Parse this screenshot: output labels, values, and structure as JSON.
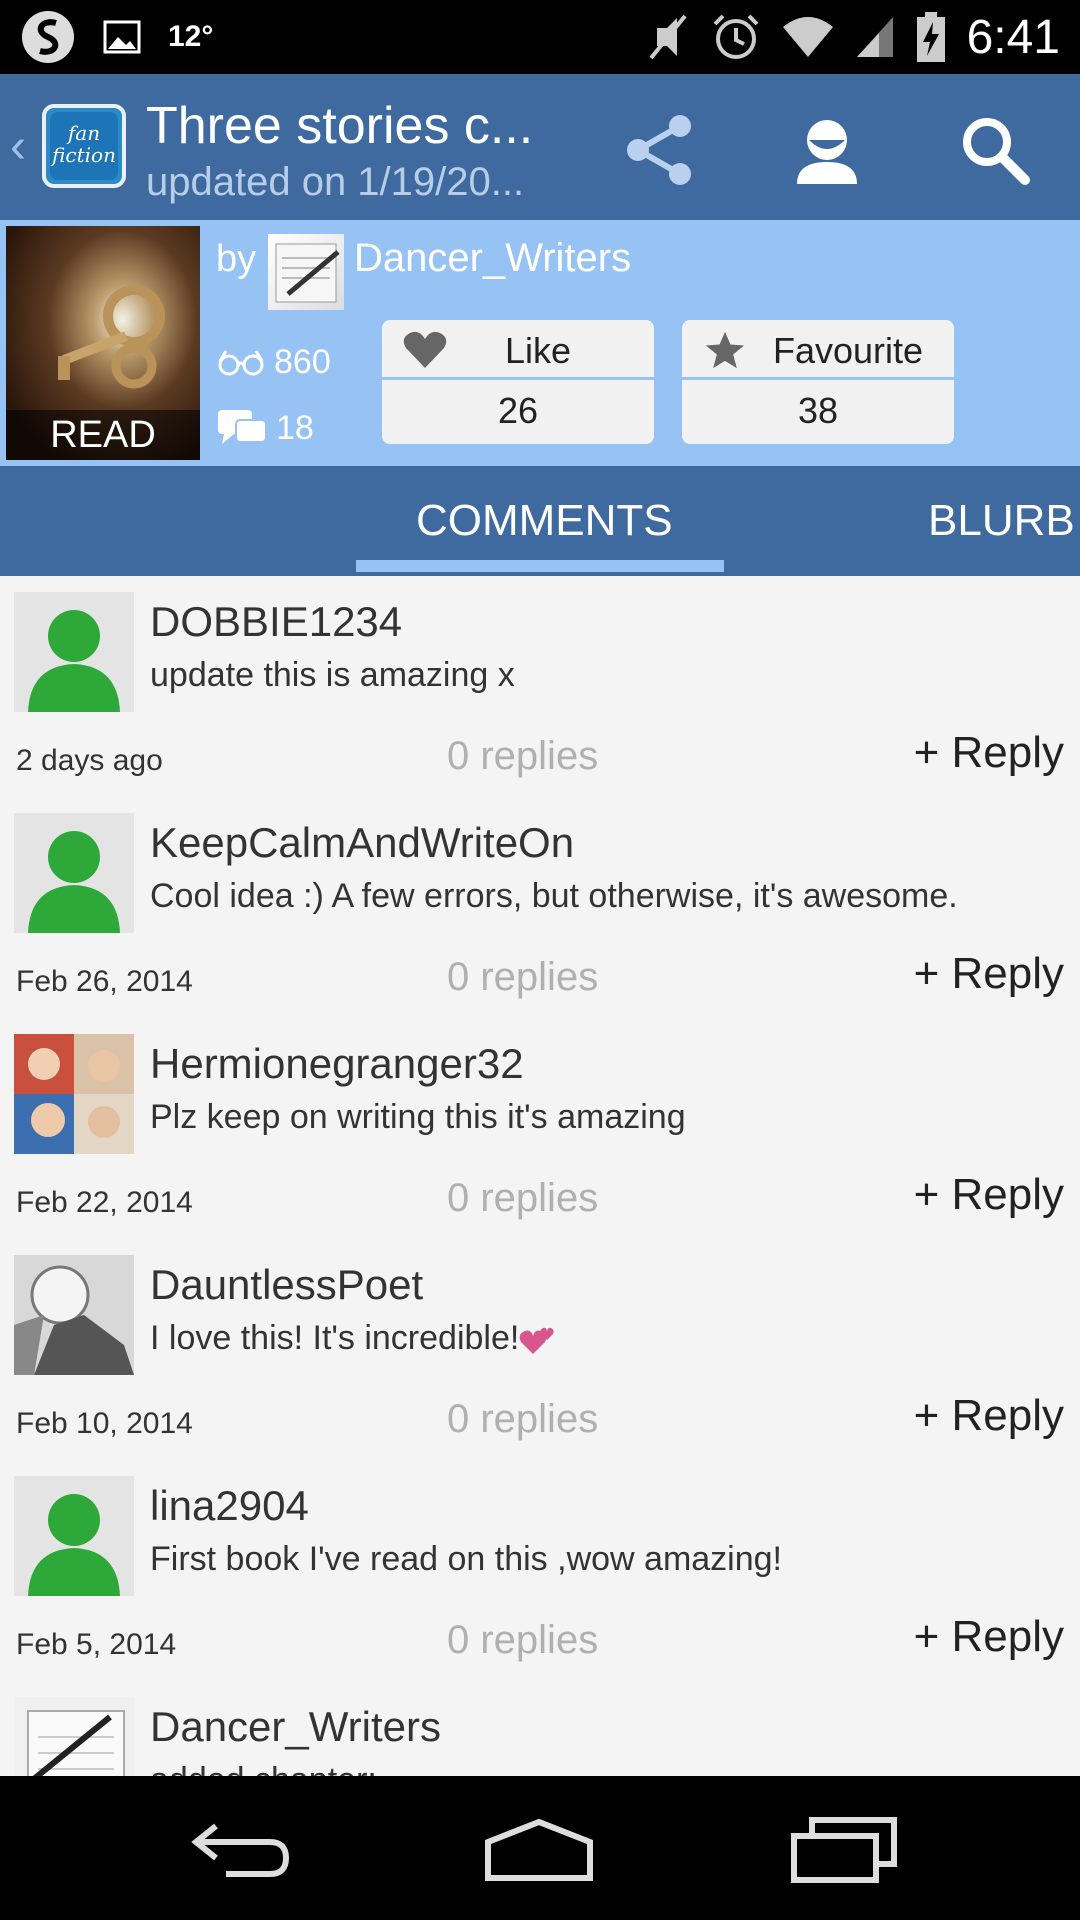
{
  "status_bar": {
    "temperature": "12°",
    "time": "6:41",
    "icons": [
      "swype-icon",
      "image-notification-icon",
      "mute-icon",
      "alarm-icon",
      "wifi-icon",
      "cell-signal-icon",
      "battery-charging-icon"
    ]
  },
  "action_bar": {
    "title": "Three stories c...",
    "subtitle": "updated on 1/19/20...",
    "logo_text": "fan fiction",
    "icons": [
      "share-icon",
      "profile-icon",
      "search-icon"
    ]
  },
  "story": {
    "cover_label": "READ",
    "by_label": "by",
    "author": "Dancer_Writers",
    "views": "860",
    "comments_count": "18",
    "like": {
      "label": "Like",
      "count": "26"
    },
    "favourite": {
      "label": "Favourite",
      "count": "38"
    }
  },
  "tabs": [
    {
      "label": "COMMENTS",
      "selected": true
    },
    {
      "label": "BLURB",
      "selected": false
    }
  ],
  "comments": [
    {
      "user": "DOBBIE1234",
      "text": "update this is amazing x",
      "date": "2 days ago",
      "replies": "0 replies",
      "reply_label": "+ Reply",
      "avatar": "default"
    },
    {
      "user": "KeepCalmAndWriteOn",
      "text": "Cool idea :) A few errors, but otherwise, it's awesome.",
      "date": "Feb 26, 2014",
      "replies": "0 replies",
      "reply_label": "+ Reply",
      "avatar": "default"
    },
    {
      "user": "Hermionegranger32",
      "text": "Plz keep on writing this it's amazing",
      "date": "Feb 22, 2014",
      "replies": "0 replies",
      "reply_label": "+ Reply",
      "avatar": "photo-band"
    },
    {
      "user": "DauntlessPoet",
      "text": "I love this! It's incredible!",
      "date": "Feb 10, 2014",
      "replies": "0 replies",
      "reply_label": "+ Reply",
      "avatar": "photo-bw"
    },
    {
      "user": "lina2904",
      "text": "First book I've read on this ,wow amazing!",
      "date": "Feb 5, 2014",
      "replies": "0 replies",
      "reply_label": "+ Reply",
      "avatar": "default"
    },
    {
      "user": "Dancer_Writers",
      "text": "added chapter:",
      "date": "",
      "replies": "",
      "reply_label": "",
      "avatar": "photo-notebook"
    }
  ],
  "colors": {
    "action_bar": "#3f6aa0",
    "header_bg": "#97c3f4",
    "default_avatar_green": "#2fa83a"
  }
}
